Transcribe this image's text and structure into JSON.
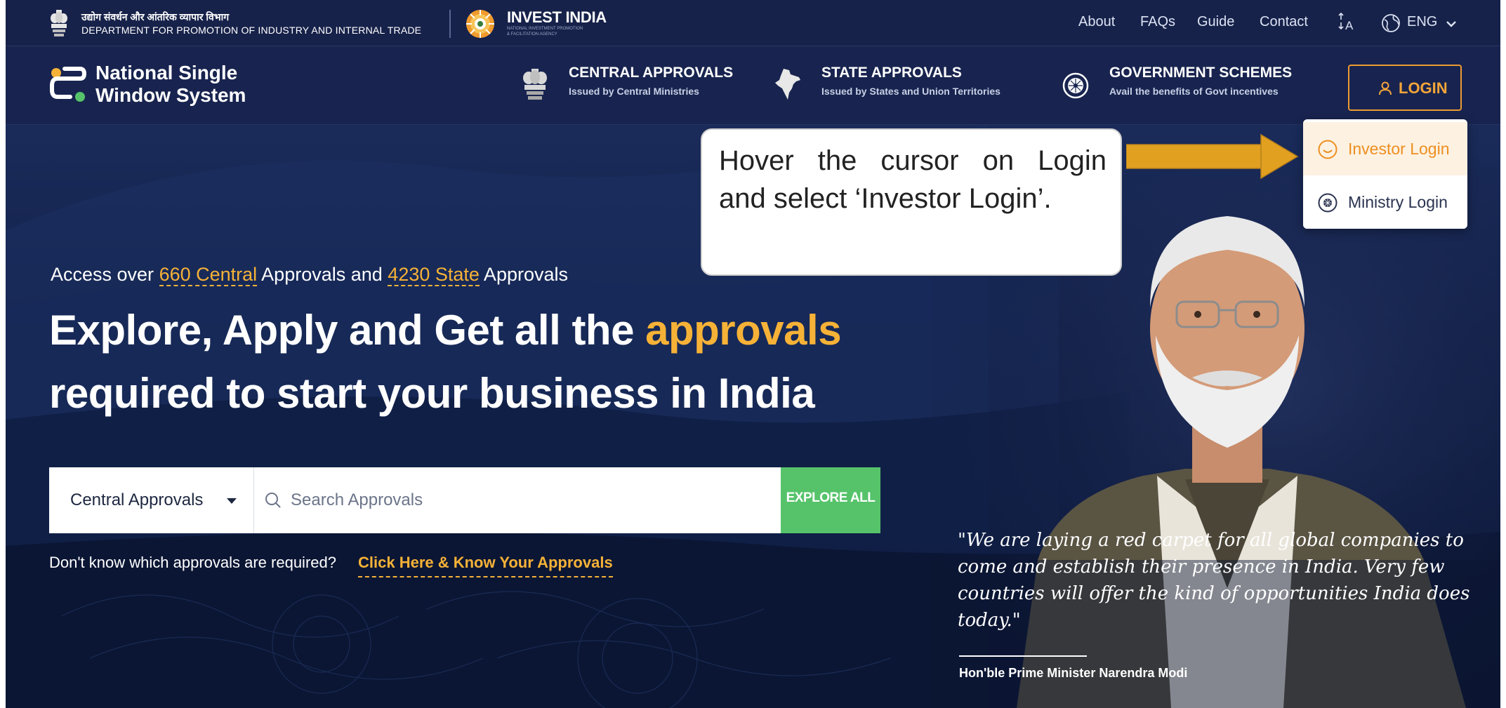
{
  "topbar": {
    "dept_hindi": "उद्योग संवर्धन और आंतरिक व्यापार विभाग",
    "dept_english": "DEPARTMENT FOR PROMOTION OF INDUSTRY AND INTERNAL TRADE",
    "invest_india_title": "INVEST INDIA",
    "invest_india_sub1": "NATIONAL INVESTMENT PROMOTION",
    "invest_india_sub2": "& FACILITATION AGENCY",
    "links": {
      "about": "About",
      "faqs": "FAQs",
      "guide": "Guide",
      "contact": "Contact"
    },
    "language": "ENG"
  },
  "navbar": {
    "logo_line1": "National Single",
    "logo_line2": "Window System",
    "central": {
      "title": "CENTRAL APPROVALS",
      "subtitle": "Issued by Central Ministries"
    },
    "state": {
      "title": "STATE APPROVALS",
      "subtitle": "Issued by States and Union Territories"
    },
    "schemes": {
      "title": "GOVERNMENT SCHEMES",
      "subtitle": "Avail the benefits of Govt incentives"
    },
    "login_label": "LOGIN"
  },
  "login_dropdown": {
    "investor_login": "Investor Login",
    "ministry_login": "Ministry Login"
  },
  "callout": {
    "line1": "Hover the cursor on Login",
    "line2": "and select ‘Investor Login’."
  },
  "hero": {
    "access_prefix": "Access over ",
    "central_link": "660 Central",
    "access_middle": " Approvals and ",
    "state_link": "4230 State",
    "access_suffix": " Approvals",
    "headline_line1_prefix": "Explore, Apply and Get all the ",
    "headline_highlight": "approvals",
    "headline_line2": "required to start your business in India",
    "select_value": "Central Approvals",
    "search_placeholder": "Search Approvals",
    "explore_label": "EXPLORE ALL",
    "know_text": "Don't know which approvals are required?",
    "know_link": "Click Here & Know Your Approvals"
  },
  "quote": {
    "text": "\"We are laying a red carpet for all global companies to come and establish their presence in India. Very few countries will offer the kind of opportunities India does today.\"",
    "author": "Hon'ble Prime Minister Narendra Modi"
  },
  "colors": {
    "navy": "#18244f",
    "accent_orange": "#f6b237",
    "explore_green": "#56c36a",
    "login_border": "#ed9b33"
  }
}
